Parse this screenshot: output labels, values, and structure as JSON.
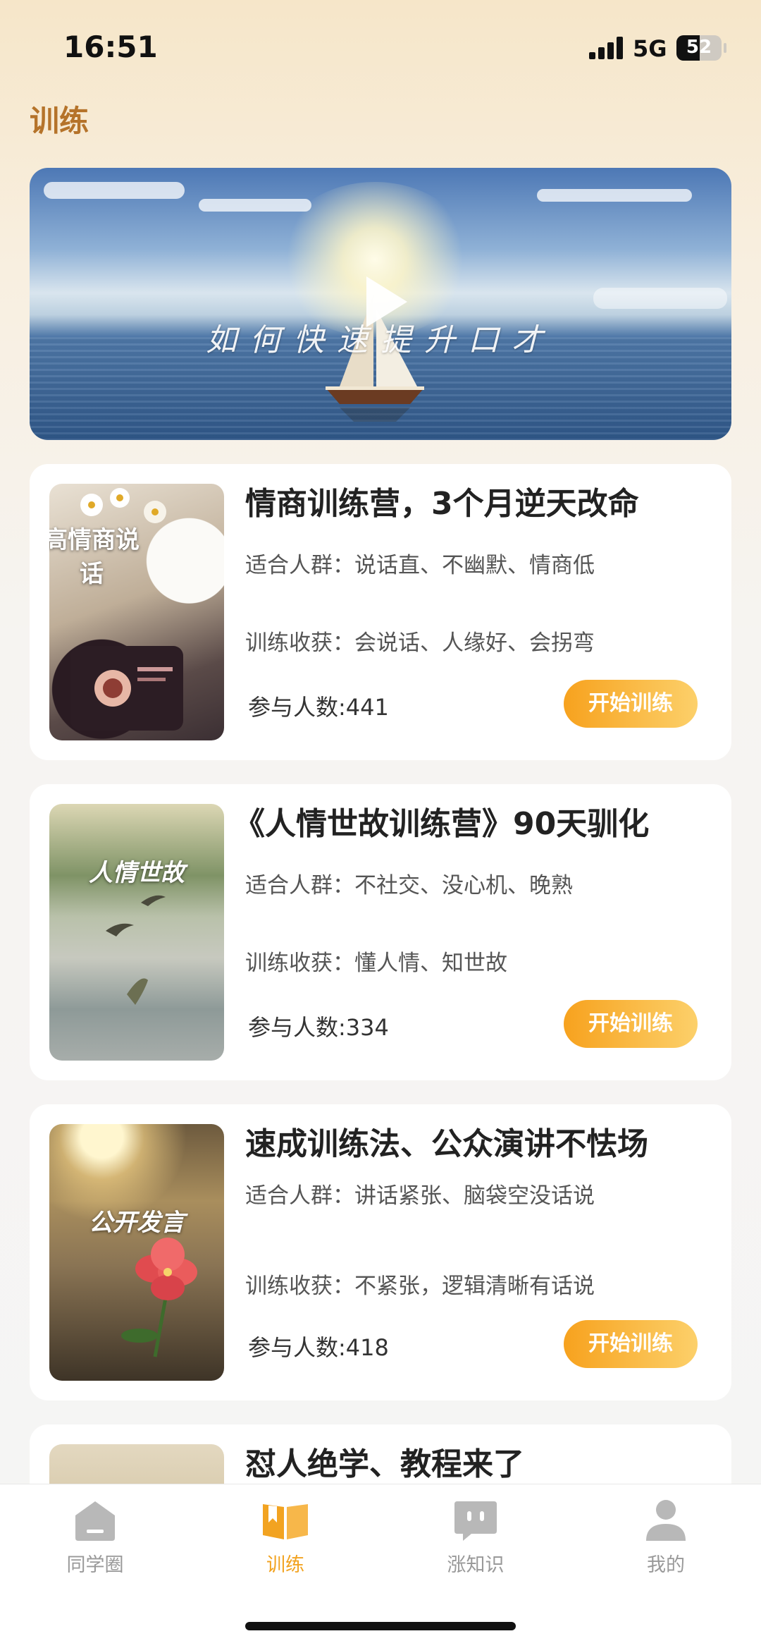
{
  "status_bar": {
    "time": "16:51",
    "network": "5G",
    "battery": "52",
    "battery_level": 0.52
  },
  "page": {
    "title": "训练"
  },
  "banner": {
    "caption": "如何快速提升口才"
  },
  "courses": [
    {
      "thumb_label": "高情商说话",
      "title": "情商训练营，3个月逆天改命",
      "audience": "适合人群：说话直、不幽默、情商低",
      "gain": "训练收获：会说话、人缘好、会拐弯",
      "participants": "参与人数:441",
      "button": "开始训练"
    },
    {
      "thumb_label": "人情世故",
      "title": "《人情世故训练营》90天驯化",
      "audience": "适合人群：不社交、没心机、晚熟",
      "gain": "训练收获：懂人情、知世故",
      "participants": "参与人数:334",
      "button": "开始训练"
    },
    {
      "thumb_label": "公开发言",
      "title": "速成训练法、公众演讲不怯场",
      "audience": "适合人群：讲话紧张、脑袋空没话说",
      "gain": "训练收获：不紧张，逻辑清晰有话说",
      "participants": "参与人数:418",
      "button": "开始训练"
    },
    {
      "title": "怼人绝学、教程来了"
    }
  ],
  "tabbar": {
    "items": [
      {
        "label": "同学圈",
        "icon": "home-icon"
      },
      {
        "label": "训练",
        "icon": "book-icon",
        "active": true
      },
      {
        "label": "涨知识",
        "icon": "chat-icon"
      },
      {
        "label": "我的",
        "icon": "user-icon"
      }
    ]
  },
  "colors": {
    "accent": "#f2a321",
    "title_brown": "#b5732a",
    "button_start": "#f7a21e",
    "button_end": "#fcd06a"
  }
}
